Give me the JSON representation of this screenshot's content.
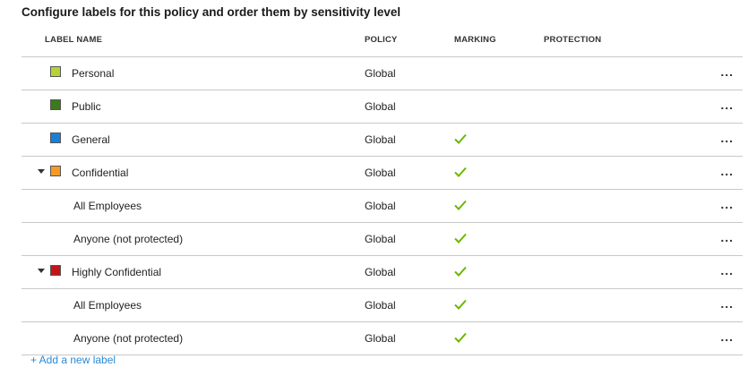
{
  "heading": "Configure labels for this policy and order them by sensitivity level",
  "columns": {
    "name": "LABEL NAME",
    "policy": "POLICY",
    "marking": "MARKING",
    "protection": "PROTECTION"
  },
  "rows": [
    {
      "name": "Personal",
      "policy": "Global",
      "color": "#b5d334",
      "level": "top",
      "expander": false,
      "marking": false
    },
    {
      "name": "Public",
      "policy": "Global",
      "color": "#3c7a1d",
      "level": "top",
      "expander": false,
      "marking": false
    },
    {
      "name": "General",
      "policy": "Global",
      "color": "#1a7fd6",
      "level": "top",
      "expander": false,
      "marking": true
    },
    {
      "name": "Confidential",
      "policy": "Global",
      "color": "#f59a23",
      "level": "top",
      "expander": true,
      "marking": true
    },
    {
      "name": "All Employees",
      "policy": "Global",
      "level": "sub",
      "expander": false,
      "marking": true
    },
    {
      "name": "Anyone (not protected)",
      "policy": "Global",
      "level": "sub",
      "expander": false,
      "marking": true
    },
    {
      "name": "Highly Confidential",
      "policy": "Global",
      "color": "#c4141a",
      "level": "top",
      "expander": true,
      "marking": true
    },
    {
      "name": "All Employees",
      "policy": "Global",
      "level": "sub",
      "expander": false,
      "marking": true
    },
    {
      "name": "Anyone (not protected)",
      "policy": "Global",
      "level": "sub",
      "expander": false,
      "marking": true
    }
  ],
  "more_label": "...",
  "add_link": "+ Add a new label",
  "check_color": "#6bb700"
}
